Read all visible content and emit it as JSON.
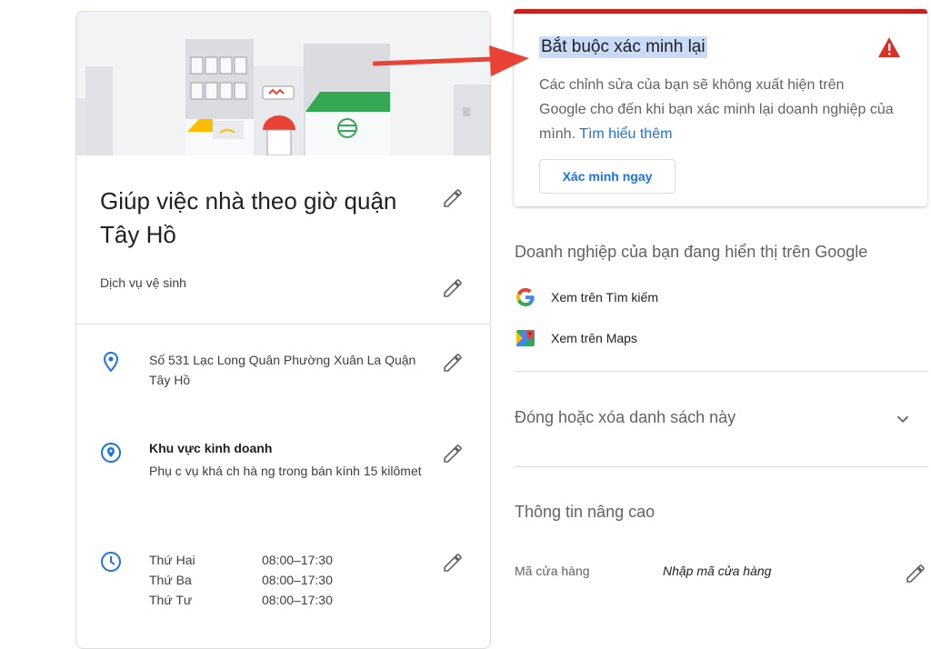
{
  "business": {
    "title": "Giúp việc nhà theo giờ quận Tây Hồ",
    "category": "Dịch vụ vệ sinh",
    "address": "Số 531 Lạc Long Quân Phường Xuân La Quận Tây Hồ",
    "service_area_title": "Khu vực kinh doanh",
    "service_area_desc": "Phụ c vụ  khá ch hà ng trong bán kính 15 kilômet",
    "hours": [
      {
        "day": "Thứ Hai",
        "time": "08:00–17:30"
      },
      {
        "day": "Thứ Ba",
        "time": "08:00–17:30"
      },
      {
        "day": "Thứ Tư",
        "time": "08:00–17:30"
      }
    ]
  },
  "alert": {
    "title": "Bắt buộc xác minh lại",
    "body": "Các chỉnh sửa của bạn sẽ không xuất hiện trên Google cho đến khi bạn xác minh lại doanh nghiệp của mình.",
    "link": "Tìm hiểu thêm",
    "button": "Xác minh ngay",
    "accent": "#c5221f"
  },
  "google_section": {
    "title": "Doanh nghiệp của bạn đang hiển thị trên Google",
    "search_link": "Xem trên Tìm kiếm",
    "maps_link": "Xem trên Maps"
  },
  "close_section": {
    "title": "Đóng hoặc xóa danh sách này"
  },
  "advanced": {
    "title": "Thông tin nâng cao",
    "store_code_label": "Mã cửa hàng",
    "store_code_placeholder": "Nhập mã cửa hàng"
  },
  "icons": {
    "edit": "pencil-icon",
    "location": "location-pin-icon",
    "service_area": "service-area-icon",
    "hours": "clock-icon",
    "warning": "warning-icon",
    "google": "google-g-icon",
    "maps": "google-maps-icon",
    "expand": "chevron-down-icon"
  }
}
